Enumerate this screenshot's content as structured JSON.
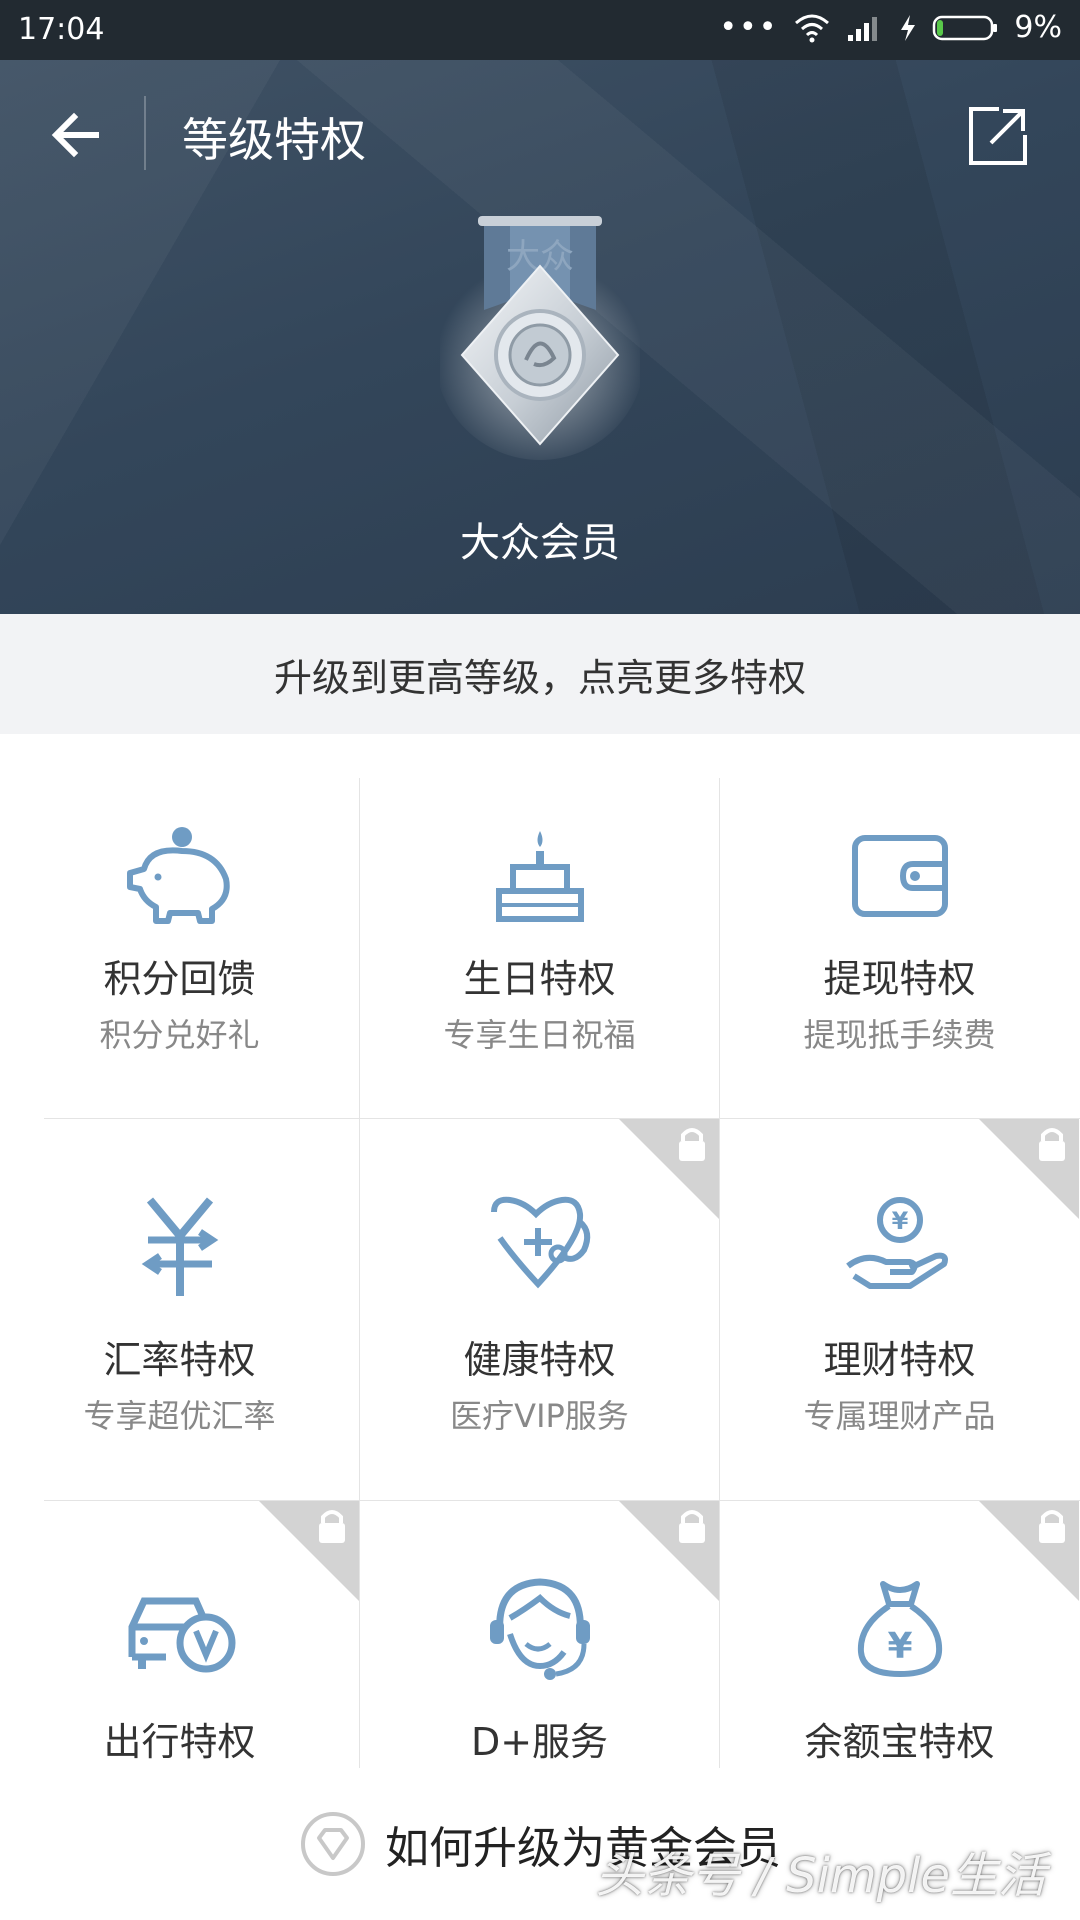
{
  "status_bar": {
    "time": "17:04",
    "battery": "9%"
  },
  "header": {
    "title": "等级特权"
  },
  "hero": {
    "badge_text": "大众",
    "level": "大众会员"
  },
  "tip": "升级到更高等级，点亮更多特权",
  "privileges": [
    {
      "name": "积分回馈",
      "desc": "积分兑好礼",
      "icon": "piggy-bank-icon",
      "locked": false
    },
    {
      "name": "生日特权",
      "desc": "专享生日祝福",
      "icon": "birthday-cake-icon",
      "locked": false
    },
    {
      "name": "提现特权",
      "desc": "提现抵手续费",
      "icon": "wallet-icon",
      "locked": false
    },
    {
      "name": "汇率特权",
      "desc": "专享超优汇率",
      "icon": "exchange-rate-icon",
      "locked": false
    },
    {
      "name": "健康特权",
      "desc": "医疗VIP服务",
      "icon": "stethoscope-icon",
      "locked": true
    },
    {
      "name": "理财特权",
      "desc": "专属理财产品",
      "icon": "coin-hand-icon",
      "locked": true
    },
    {
      "name": "出行特权",
      "desc": "",
      "icon": "car-vip-icon",
      "locked": true
    },
    {
      "name": "D+服务",
      "desc": "",
      "icon": "headset-service-icon",
      "locked": true
    },
    {
      "name": "余额宝特权",
      "desc": "",
      "icon": "money-bag-icon",
      "locked": true
    }
  ],
  "bottom": {
    "link_text": "如何升级为黄金会员"
  },
  "watermark": "头条号 / Simple生活",
  "colors": {
    "icon": "#6f9cc4",
    "hero": "#33465a",
    "lock_corner": "#d3d3d3"
  }
}
